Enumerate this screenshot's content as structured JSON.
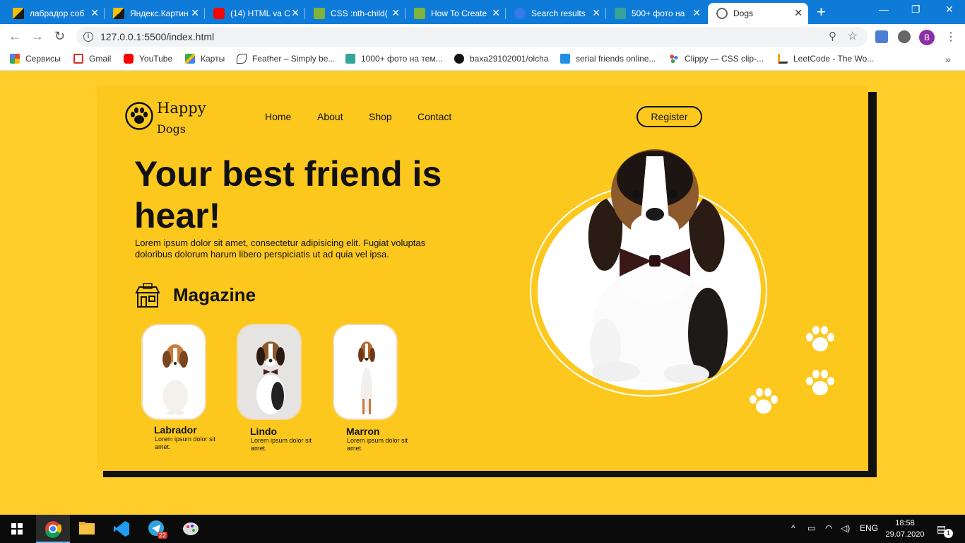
{
  "browser": {
    "tabs": [
      {
        "title": "лабрадор соб",
        "icon": "image-icon"
      },
      {
        "title": "Яндекс.Картин",
        "icon": "image-icon"
      },
      {
        "title": "(14) HTML va C",
        "icon": "youtube-icon"
      },
      {
        "title": "CSS :nth-child(",
        "icon": "codepen-icon"
      },
      {
        "title": "How To Create",
        "icon": "codepen-icon"
      },
      {
        "title": "Search results",
        "icon": "search-icon"
      },
      {
        "title": "500+ фото на",
        "icon": "d-icon"
      },
      {
        "title": "Dogs",
        "icon": "globe-icon"
      }
    ],
    "url": "127.0.0.1:5500/index.html",
    "profile_initial": "B",
    "bookmarks": [
      {
        "label": "Сервисы",
        "icon": "apps-icon"
      },
      {
        "label": "Gmail",
        "icon": "gmail-icon"
      },
      {
        "label": "YouTube",
        "icon": "youtube-icon"
      },
      {
        "label": "Карты",
        "icon": "maps-icon"
      },
      {
        "label": "Feather – Simply be...",
        "icon": "feather-icon"
      },
      {
        "label": "1000+ фото на тем...",
        "icon": "d-icon"
      },
      {
        "label": "baxa29102001/olcha",
        "icon": "github-icon"
      },
      {
        "label": "serial friends online...",
        "icon": "l-icon"
      },
      {
        "label": "Clippy — CSS clip-...",
        "icon": "clippy-icon"
      },
      {
        "label": "LeetCode - The Wo...",
        "icon": "leetcode-icon"
      }
    ]
  },
  "site": {
    "logo": {
      "line1": "Happy",
      "line2": "Dogs"
    },
    "nav": [
      "Home",
      "About",
      "Shop",
      "Contact"
    ],
    "register": "Register",
    "hero": {
      "title": "Your best friend is hear!",
      "text": "Lorem ipsum dolor sit amet, consectetur adipisicing elit. Fugiat voluptas doloribus dolorum harum libero perspiciatis ut ad quia vel ipsa."
    },
    "magazine": {
      "title": "Magazine",
      "items": [
        {
          "name": "Labrador",
          "desc": "Lorem ipsum dolor sit amet."
        },
        {
          "name": "Lindo",
          "desc": "Lorem ipsum dolor sit amet."
        },
        {
          "name": "Marron",
          "desc": "Lorem ipsum dolor sit amet."
        }
      ]
    }
  },
  "taskbar": {
    "lang": "ENG",
    "time": "18:58",
    "date": "29.07.2020",
    "telegram_badge": "22",
    "notification_count": "1"
  },
  "colors": {
    "page_bg": "#ffce2b",
    "card_bg": "#fcc81e",
    "tabstrip": "#0f7bd9",
    "text": "#111111"
  }
}
